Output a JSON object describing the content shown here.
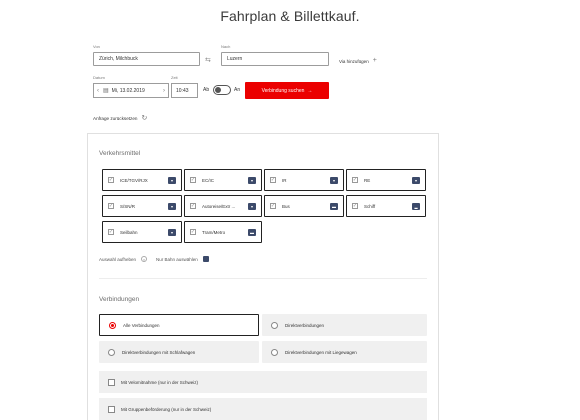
{
  "page": {
    "title": "Fahrplan & Billettkauf."
  },
  "form": {
    "from_label": "Von",
    "from_value": "Zürich, Milchbuck",
    "to_label": "Nach",
    "to_value": "Luzern",
    "via_label": "Via hinzufügen",
    "date_label": "Datum",
    "date_value": "Mi, 13.02.2019",
    "time_label": "Zeit",
    "time_value": "10:43",
    "ab_label": "Ab",
    "an_label": "An",
    "search_label": "Verbindung suchen",
    "reset_label": "Anfrage zurücksetzen"
  },
  "modes": {
    "title": "Verkehrsmittel",
    "items": [
      {
        "label": "ICE/TGV/RJX"
      },
      {
        "label": "EC/IC"
      },
      {
        "label": "IR"
      },
      {
        "label": "RE"
      },
      {
        "label": "S/SN/R"
      },
      {
        "label": "Autoreise/Extr ..."
      },
      {
        "label": "Bus"
      },
      {
        "label": "Schiff"
      },
      {
        "label": "Seilbahn"
      },
      {
        "label": "Tram/Metro"
      }
    ],
    "deselect_label": "Auswahl aufheben",
    "train_only_label": "Nur Bahn auswählen"
  },
  "connections": {
    "title": "Verbindungen",
    "options": [
      {
        "label": "Alle Verbindungen",
        "selected": true
      },
      {
        "label": "Direktverbindungen",
        "selected": false
      },
      {
        "label": "Direktverbindungen mit Schlafwagen",
        "selected": false
      },
      {
        "label": "Direktverbindungen mit Liegewagen",
        "selected": false
      }
    ],
    "extras": [
      {
        "label": "Mit Velomitnahme (nur in der Schweiz)"
      },
      {
        "label": "Mit Gruppenbeförderung (nur in der Schweiz)"
      }
    ]
  },
  "colors": {
    "accent": "#eb0000",
    "icon": "#3c4a6a"
  }
}
